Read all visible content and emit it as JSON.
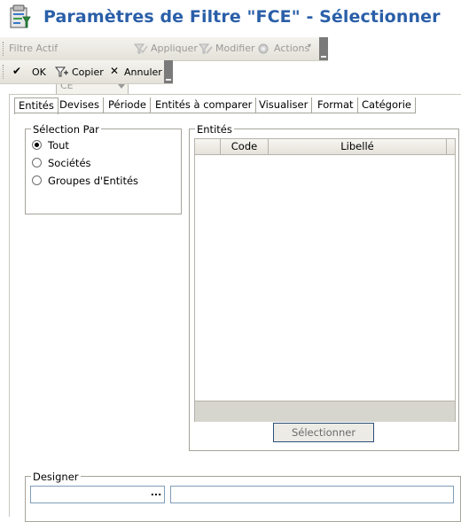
{
  "window": {
    "title": "Paramètres de Filtre \"FCE\" - Sélectionner",
    "icon": "filter-settings-icon"
  },
  "toolbar_primary": {
    "filter_label": "Filtre Actif",
    "filter_value": "CE",
    "apply_label": "Appliquer",
    "modify_label": "Modifier",
    "actions_label": "Actions"
  },
  "toolbar_secondary": {
    "ok_label": "OK",
    "copy_label": "Copier",
    "cancel_label": "Annuler"
  },
  "tabs": [
    {
      "label": "Entités",
      "active": true
    },
    {
      "label": "Devises"
    },
    {
      "label": "Période"
    },
    {
      "label": "Entités à comparer"
    },
    {
      "label": "Visualiser"
    },
    {
      "label": "Format"
    },
    {
      "label": "Catégorie"
    }
  ],
  "selection": {
    "legend": "Sélection Par",
    "options": [
      {
        "label": "Tout",
        "checked": true
      },
      {
        "label": "Sociétés",
        "checked": false
      },
      {
        "label": "Groupes d'Entités",
        "checked": false
      }
    ]
  },
  "entities": {
    "legend": "Entités",
    "columns": [
      "Code",
      "Libellé"
    ],
    "rows": [],
    "select_button": "Sélectionner"
  },
  "designer": {
    "legend": "Designer",
    "field1_value": "",
    "field2_value": "",
    "browse_button": "..."
  },
  "colors": {
    "title": "#2a5fa8",
    "border": "#a5a39a",
    "button_border": "#2d4f7a"
  }
}
